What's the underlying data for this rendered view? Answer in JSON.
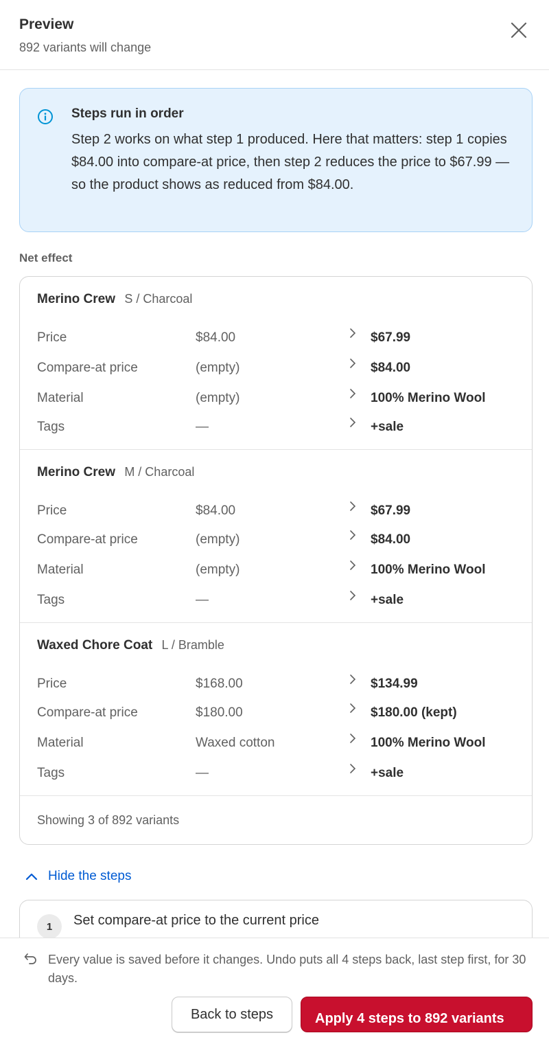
{
  "header": {
    "title": "Preview",
    "subtitle": "892 variants will change"
  },
  "banner": {
    "title": "Steps run in order",
    "body": "Step 2 works on what step 1 produced. Here that matters: step 1 copies $84.00 into compare-at price, then step 2 reduces the price to $67.99 — so the product shows as reduced from $84.00."
  },
  "net_effect": {
    "label": "Net effect",
    "variants": [
      {
        "name": "Merino Crew",
        "option": "S / Charcoal",
        "rows": [
          {
            "field": "Price",
            "old": "$84.00",
            "new": "$67.99"
          },
          {
            "field": "Compare-at price",
            "old": "(empty)",
            "new": "$84.00"
          },
          {
            "field": "Material",
            "old": "(empty)",
            "new": "100% Merino Wool"
          },
          {
            "field": "Tags",
            "old": "—",
            "new": "+sale"
          }
        ]
      },
      {
        "name": "Merino Crew",
        "option": "M / Charcoal",
        "rows": [
          {
            "field": "Price",
            "old": "$84.00",
            "new": "$67.99"
          },
          {
            "field": "Compare-at price",
            "old": "(empty)",
            "new": "$84.00"
          },
          {
            "field": "Material",
            "old": "(empty)",
            "new": "100% Merino Wool"
          },
          {
            "field": "Tags",
            "old": "—",
            "new": "+sale"
          }
        ]
      },
      {
        "name": "Waxed Chore Coat",
        "option": "L / Bramble",
        "rows": [
          {
            "field": "Price",
            "old": "$168.00",
            "new": "$134.99"
          },
          {
            "field": "Compare-at price",
            "old": "$180.00",
            "new": "$180.00 (kept)"
          },
          {
            "field": "Material",
            "old": "Waxed cotton",
            "new": "100% Merino Wool"
          },
          {
            "field": "Tags",
            "old": "—",
            "new": "+sale"
          }
        ]
      }
    ],
    "footer": "Showing 3 of 892 variants"
  },
  "steps_toggle": {
    "label": "Hide the steps"
  },
  "steps": [
    {
      "number": "1",
      "text": "Set compare-at price to the current price"
    }
  ],
  "footer": {
    "undo_text": "Every value is saved before it changes. Undo puts all 4 steps back, last step first, for 30 days.",
    "back_label": "Back to steps",
    "apply_label": "Apply 4 steps to 892 variants"
  },
  "colors": {
    "accent": "#005bd3",
    "critical": "#c8102e",
    "info_bg": "#e5f2fd",
    "info_icon": "#0094d5"
  }
}
